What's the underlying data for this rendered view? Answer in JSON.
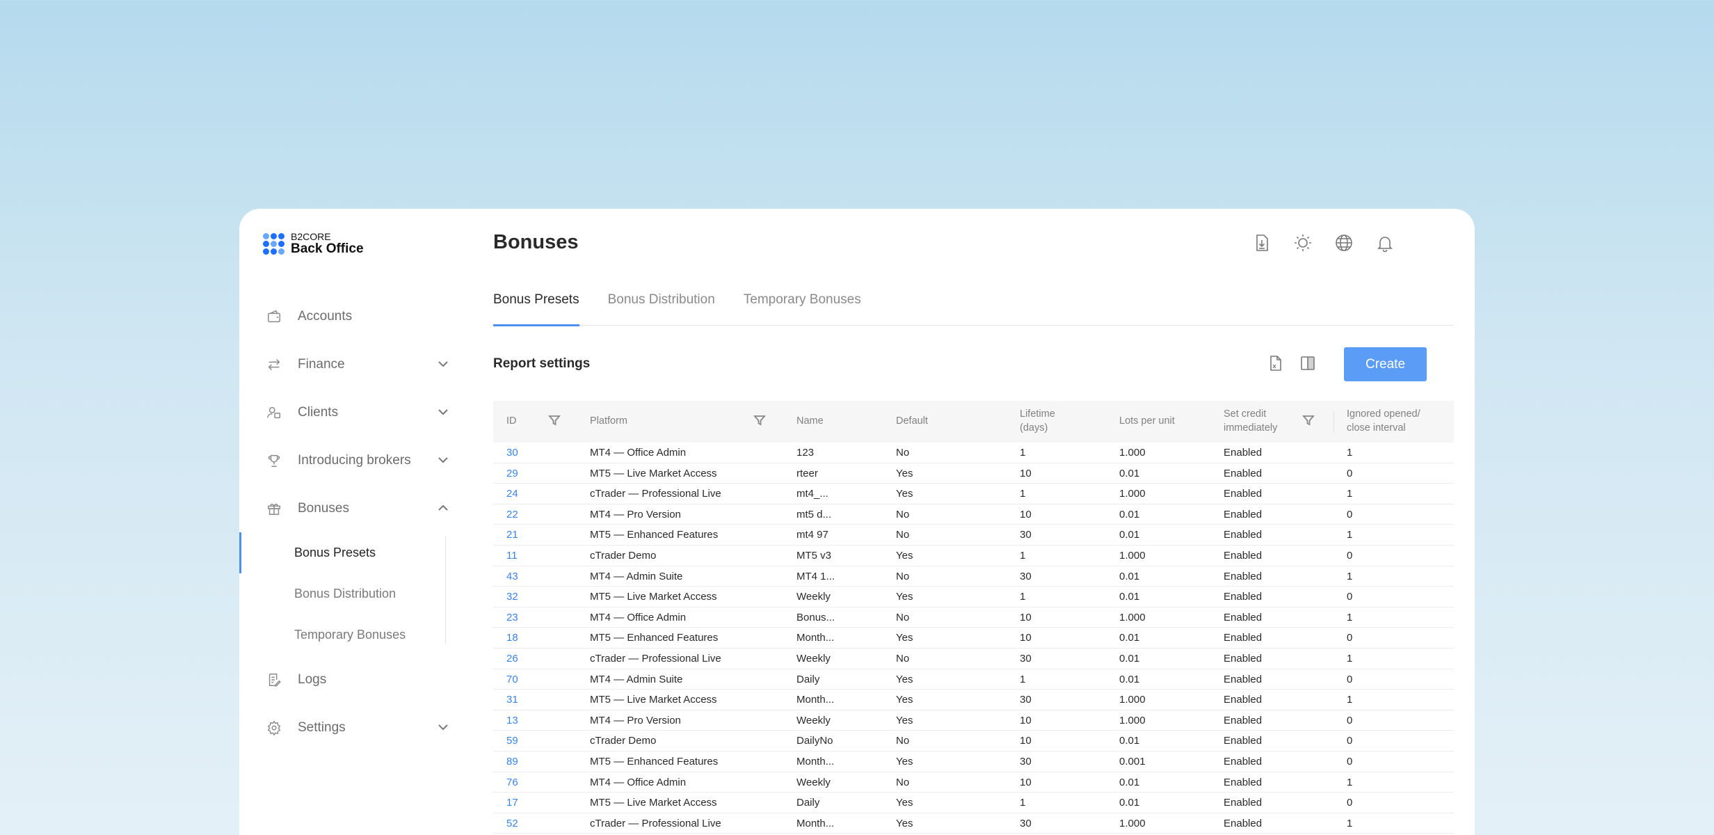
{
  "app": {
    "brand_small": "B2CORE",
    "brand_big": "Back Office"
  },
  "sidebar": {
    "items": [
      {
        "label": "Accounts",
        "icon": "wallet-icon"
      },
      {
        "label": "Finance",
        "icon": "transfer-icon",
        "expandable": true,
        "expanded": false
      },
      {
        "label": "Clients",
        "icon": "clients-icon",
        "expandable": true,
        "expanded": false
      },
      {
        "label": "Introducing brokers",
        "icon": "trophy-icon",
        "expandable": true,
        "expanded": false
      },
      {
        "label": "Bonuses",
        "icon": "gift-icon",
        "expandable": true,
        "expanded": true
      },
      {
        "label": "Logs",
        "icon": "logs-icon"
      },
      {
        "label": "Settings",
        "icon": "gear-icon",
        "expandable": true,
        "expanded": false
      }
    ],
    "bonuses_sub": [
      {
        "label": "Bonus Presets",
        "active": true
      },
      {
        "label": "Bonus Distribution"
      },
      {
        "label": "Temporary Bonuses"
      }
    ]
  },
  "header": {
    "title": "Bonuses",
    "icons": [
      "download-doc-icon",
      "sun-icon",
      "globe-icon",
      "bell-icon"
    ]
  },
  "tabs": [
    {
      "label": "Bonus Presets",
      "active": true
    },
    {
      "label": "Bonus Distribution"
    },
    {
      "label": "Temporary Bonuses"
    }
  ],
  "report": {
    "title": "Report settings",
    "icons": [
      "xls-export-icon",
      "columns-icon"
    ],
    "create_label": "Create"
  },
  "table": {
    "columns": [
      "ID",
      "Platform",
      "Name",
      "Default",
      "Lifetime (days)",
      "Lots per unit",
      "Set credit immediately",
      "Ignored opened/ close interval"
    ],
    "rows": [
      [
        "30",
        "MT4 — Office Admin",
        "123",
        "No",
        "1",
        "1.000",
        "Enabled",
        "1"
      ],
      [
        "29",
        "MT5 — Live Market Access",
        "rteer",
        "Yes",
        "10",
        "0.01",
        "Enabled",
        "0"
      ],
      [
        "24",
        "cTrader — Professional Live",
        "mt4_...",
        "Yes",
        "1",
        "1.000",
        "Enabled",
        "1"
      ],
      [
        "22",
        "MT4 — Pro Version",
        "mt5 d...",
        "No",
        "10",
        "0.01",
        "Enabled",
        "0"
      ],
      [
        "21",
        "MT5 — Enhanced Features",
        "mt4 97",
        "No",
        "30",
        "0.01",
        "Enabled",
        "1"
      ],
      [
        "11",
        "cTrader Demo",
        "MT5 v3",
        "Yes",
        "1",
        "1.000",
        "Enabled",
        "0"
      ],
      [
        "43",
        "MT4 — Admin Suite",
        "MT4 1...",
        "No",
        "30",
        "0.01",
        "Enabled",
        "1"
      ],
      [
        "32",
        "MT5 — Live Market Access",
        "Weekly",
        "Yes",
        "1",
        "0.01",
        "Enabled",
        "0"
      ],
      [
        "23",
        "MT4 — Office Admin",
        "Bonus...",
        "No",
        "10",
        "1.000",
        "Enabled",
        "1"
      ],
      [
        "18",
        "MT5 — Enhanced Features",
        "Month...",
        "Yes",
        "10",
        "0.01",
        "Enabled",
        "0"
      ],
      [
        "26",
        "cTrader — Professional Live",
        "Weekly",
        "No",
        "30",
        "0.01",
        "Enabled",
        "1"
      ],
      [
        "70",
        "MT4 — Admin Suite",
        "Daily",
        "Yes",
        "1",
        "0.01",
        "Enabled",
        "0"
      ],
      [
        "31",
        "MT5 — Live Market Access",
        "Month...",
        "Yes",
        "30",
        "1.000",
        "Enabled",
        "1"
      ],
      [
        "13",
        "MT4 — Pro Version",
        "Weekly",
        "Yes",
        "10",
        "1.000",
        "Enabled",
        "0"
      ],
      [
        "59",
        "cTrader Demo",
        "DailyNo",
        "No",
        "10",
        "0.01",
        "Enabled",
        "0"
      ],
      [
        "89",
        "MT5 — Enhanced Features",
        "Month...",
        "Yes",
        "30",
        "0.001",
        "Enabled",
        "0"
      ],
      [
        "76",
        "MT4 — Office Admin",
        "Weekly",
        "No",
        "10",
        "0.01",
        "Enabled",
        "1"
      ],
      [
        "17",
        "MT5 — Live Market Access",
        "Daily",
        "Yes",
        "1",
        "0.01",
        "Enabled",
        "0"
      ],
      [
        "52",
        "cTrader — Professional Live",
        "Month...",
        "Yes",
        "30",
        "1.000",
        "Enabled",
        "1"
      ]
    ]
  },
  "colors": {
    "accent": "#5b9cf7",
    "link": "#3b82e8"
  }
}
